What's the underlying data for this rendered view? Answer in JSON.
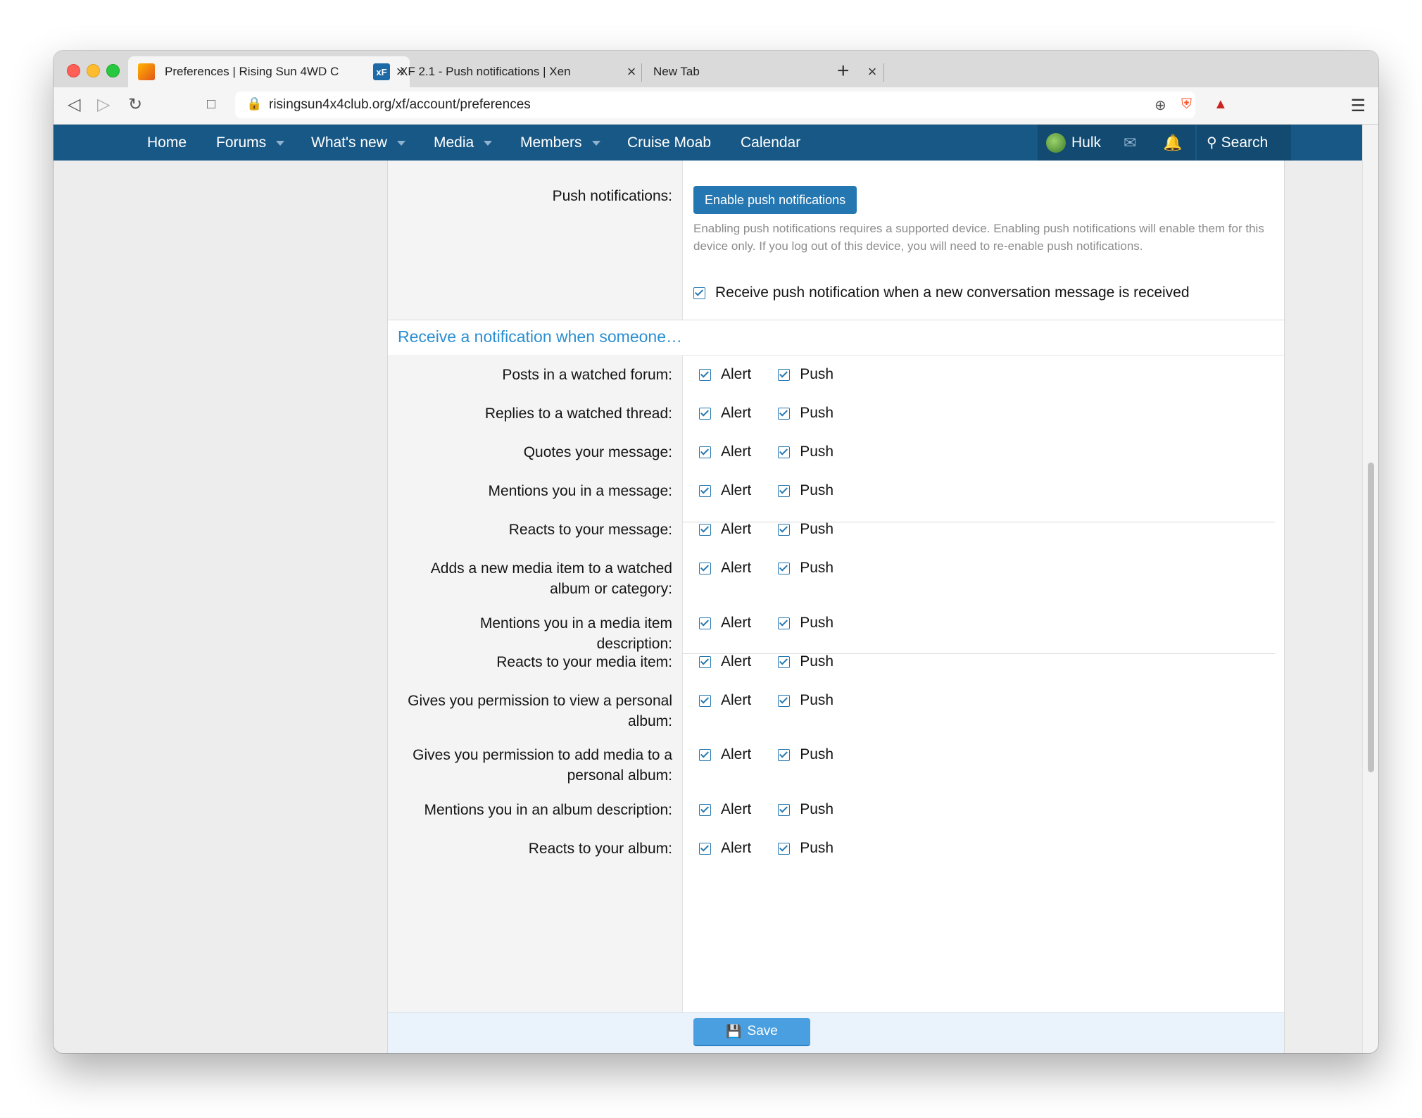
{
  "browser": {
    "tabs": [
      {
        "title": "Preferences | Rising Sun 4WD C",
        "active": true
      },
      {
        "title": "XF 2.1 - Push notifications | Xen",
        "active": false
      },
      {
        "title": "New Tab",
        "active": false
      }
    ],
    "new_tab_icon": "+",
    "close_icon": "×",
    "url": "risingsun4x4club.org/xf/account/preferences"
  },
  "nav": {
    "items": [
      {
        "label": "Home",
        "dropdown": false
      },
      {
        "label": "Forums",
        "dropdown": true
      },
      {
        "label": "What's new",
        "dropdown": true
      },
      {
        "label": "Media",
        "dropdown": true
      },
      {
        "label": "Members",
        "dropdown": true
      },
      {
        "label": "Cruise Moab",
        "dropdown": false
      },
      {
        "label": "Calendar",
        "dropdown": false
      }
    ],
    "user": "Hulk",
    "search_label": "Search",
    "background": "#185886"
  },
  "push": {
    "label": "Push notifications:",
    "button": "Enable push notifications",
    "hint": "Enabling push notifications requires a supported device. Enabling push notifications will enable them for this device only. If you log out of this device, you will need to re-enable push notifications.",
    "conversation_checkbox": "Receive push notification when a new conversation message is received"
  },
  "section": {
    "title": "Receive a notification when someone…",
    "color": "#2b8fd1"
  },
  "options": {
    "alert": "Alert",
    "push": "Push"
  },
  "rows": [
    {
      "label": "Posts in a watched forum:"
    },
    {
      "label": "Replies to a watched thread:"
    },
    {
      "label": "Quotes your message:"
    },
    {
      "label": "Mentions you in a message:"
    },
    {
      "label": "Reacts to your message:"
    },
    {
      "label": "Adds a new media item to a watched album or category:"
    },
    {
      "label": "Mentions you in a media item description:"
    },
    {
      "label": "Reacts to your media item:"
    },
    {
      "label": "Gives you permission to view a personal album:"
    },
    {
      "label": "Gives you permission to add media to a personal album:"
    },
    {
      "label": "Mentions you in an album description:"
    },
    {
      "label": "Reacts to your album:"
    }
  ],
  "save_label": "Save"
}
